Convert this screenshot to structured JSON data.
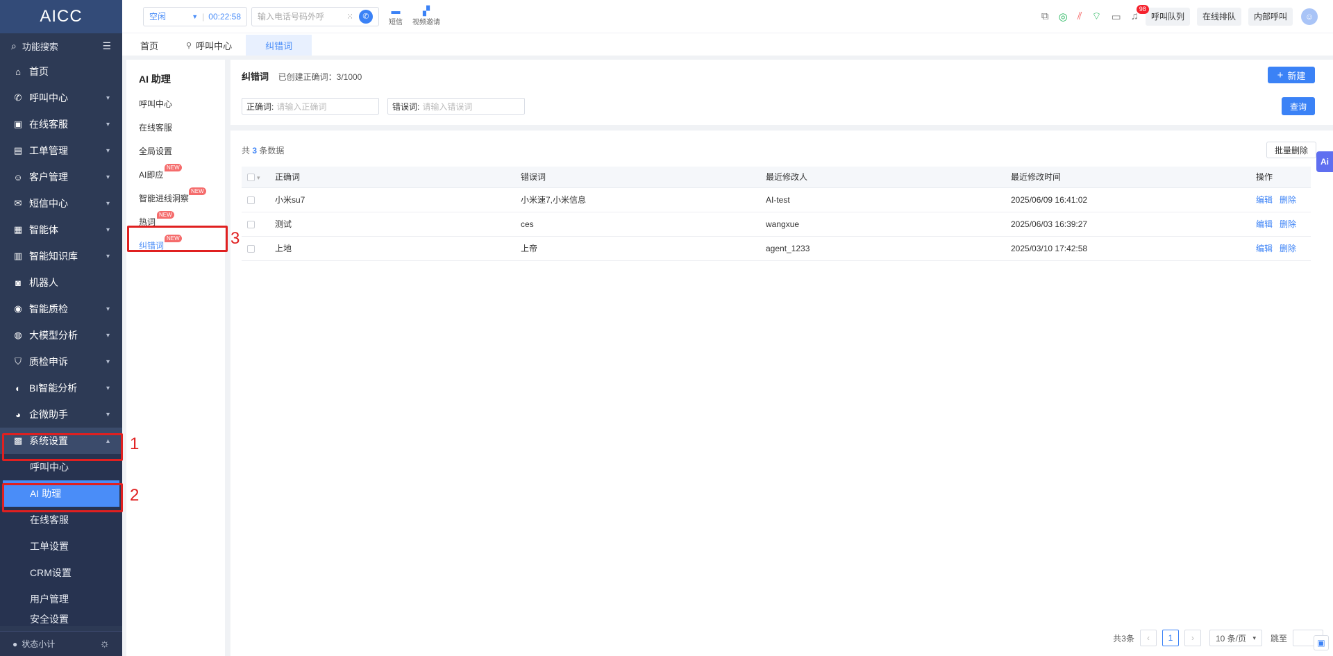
{
  "app": {
    "logo": "AICC"
  },
  "sidebar": {
    "search_label": "功能搜索",
    "items": [
      {
        "label": "首页",
        "icon": "home-icon"
      },
      {
        "label": "呼叫中心",
        "icon": "phone-icon"
      },
      {
        "label": "在线客服",
        "icon": "chat-icon"
      },
      {
        "label": "工单管理",
        "icon": "clipboard-icon"
      },
      {
        "label": "客户管理",
        "icon": "users-icon"
      },
      {
        "label": "短信中心",
        "icon": "mail-icon"
      },
      {
        "label": "智能体",
        "icon": "grid-icon"
      },
      {
        "label": "智能知识库",
        "icon": "library-icon"
      },
      {
        "label": "机器人",
        "icon": "robot-icon"
      },
      {
        "label": "智能质检",
        "icon": "inspect-icon"
      },
      {
        "label": "大模型分析",
        "icon": "model-icon"
      },
      {
        "label": "质检申诉",
        "icon": "shield-icon"
      },
      {
        "label": "BI智能分析",
        "icon": "pie-icon"
      },
      {
        "label": "企微助手",
        "icon": "wechat-icon"
      },
      {
        "label": "系统设置",
        "icon": "settings-icon"
      }
    ],
    "sub_items": [
      "呼叫中心",
      "AI 助理",
      "在线客服",
      "工单设置",
      "CRM设置",
      "用户管理",
      "安全设置"
    ],
    "bottom_label": "状态小计"
  },
  "topbar": {
    "status": "空闲",
    "timer": "00:22:58",
    "dial_placeholder": "输入电话号码外呼",
    "sms_label": "短信",
    "video_label": "视频邀请",
    "badge_count": "98",
    "btn_queue": "呼叫队列",
    "btn_online_queue": "在线排队",
    "btn_internal": "内部呼叫"
  },
  "tabs": [
    "首页",
    "呼叫中心",
    "纠错词"
  ],
  "submenu": {
    "title": "AI 助理",
    "items": [
      "呼叫中心",
      "在线客服",
      "全局设置",
      "AI即应",
      "智能进线洞察",
      "热词",
      "纠错词"
    ],
    "new_tag": "NEW"
  },
  "main": {
    "title": "纠错词",
    "created_info": "已创建正确词：3/1000",
    "new_button": "新建",
    "field_correct_label": "正确词:",
    "field_correct_placeholder": "请输入正确词",
    "field_wrong_label": "错误词:",
    "field_wrong_placeholder": "请输入错误词",
    "query_button": "查询",
    "count_prefix": "共",
    "count": "3",
    "count_suffix": "条数据",
    "bulk_delete": "批量删除",
    "columns": [
      "正确词",
      "错误词",
      "最近修改人",
      "最近修改时间",
      "操作"
    ],
    "rows": [
      {
        "correct": "小米su7",
        "wrong": "小米速7,小米信息",
        "modifier": "AI-test",
        "time": "2025/06/09 16:41:02"
      },
      {
        "correct": "测试",
        "wrong": "ces",
        "modifier": "wangxue",
        "time": "2025/06/03 16:39:27"
      },
      {
        "correct": "上地",
        "wrong": "上帝",
        "modifier": "agent_1233",
        "time": "2025/03/10 17:42:58"
      }
    ],
    "edit_label": "编辑",
    "delete_label": "删除",
    "ai_float": "Ai"
  },
  "pagination": {
    "total": "共3条",
    "current": "1",
    "page_size": "10 条/页",
    "jump_label": "跳至"
  },
  "annotations": [
    "1",
    "2",
    "3"
  ]
}
